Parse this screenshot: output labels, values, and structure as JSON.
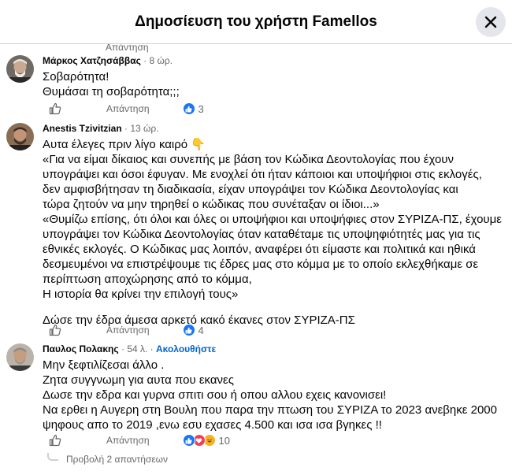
{
  "header": {
    "title": "Δημοσίευση του χρήστη Famellos"
  },
  "top_stub": {
    "reply_label": "Απάντηση"
  },
  "comments": [
    {
      "author": "Μάρκος Χατζησάββας",
      "time": "8 ώρ.",
      "lines": [
        "Σοβαρότητα!",
        "Θυμάσαι τη σοβαρότητα;;;"
      ],
      "reply_label": "Απάντηση",
      "reactions": "3"
    },
    {
      "author": "Anestis Tzivitzian",
      "time": "13 ώρ.",
      "lines": [
        "Αυτα έλεγες πριν λίγο καιρό 👇",
        "«Για να είμαι δίκαιος και συνεπής με βάση τον Κώδικα Δεοντολογίας που έχουν",
        "υπογράψει και όσοι έφυγαν. Με ενοχλεί ότι ήταν κάποιοι και υποψήφιοι στις εκλογές,",
        "δεν αμφισβήτησαν τη διαδικασία, είχαν υπογράψει τον Κώδικα Δεοντολογίας και",
        "τώρα ζητούν να μην τηρηθεί ο κώδικας που συνέταξαν οι ίδιοι...»",
        "«Θυμίζω επίσης, ότι όλοι και όλες οι υποψήφιοι και υποψήφιες στον ΣΥΡΙΖΑ-ΠΣ, έχουμε",
        "υπογράψει τον Κώδικα Δεοντολογίας όταν καταθέταμε τις υποψηφιότητές μας για τις",
        "εθνικές εκλογές. Ο Κώδικας μας λοιπόν, αναφέρει ότι είμαστε και πολιτικά και ηθικά",
        "δεσμευμένοι να επιστρέψουμε τις έδρες μας στο κόμμα με το οποίο εκλεχθήκαμε σε",
        "περίπτωση αποχώρησης από το κόμμα,",
        "Η ιστορία θα κρίνει την επιλογή τους»"
      ],
      "lines_after": [
        "Δώσε την έδρα άμεσα αρκετό κακό έκανες στον ΣΥΡΙΖΑ-ΠΣ"
      ],
      "reply_label": "Απάντηση",
      "reactions": "4"
    },
    {
      "author": "Παυλος Πολακης",
      "time": "54 λ.",
      "follow": "Ακολουθήστε",
      "lines": [
        "Μην ξεφτιλίζεσαι άλλο .",
        "Ζητα συγγνωμη για αυτα που εκανες",
        "Δωσε την εδρα και γυρνα σπιτι σου ή οπου αλλου εχεις κανονισει!",
        "Να ερθει η Αυγερη στη Βουλη που παρα την πτωση του ΣΥΡΙΖΑ το 2023 ανεβηκε 2000",
        "ψηφους απο το 2019 ,ενω εσυ εχασες 4.500 και ισα ισα βγηκες !!"
      ],
      "reply_label": "Απάντηση",
      "reactions": "10"
    }
  ],
  "view_replies": "Προβολή 2 απαντήσεων",
  "colors": {
    "like_blue": "#1877f2",
    "love_red": "#f33e58",
    "haha_yellow": "#f7b125",
    "link_blue": "#0064d1",
    "secondary": "#65676b"
  }
}
